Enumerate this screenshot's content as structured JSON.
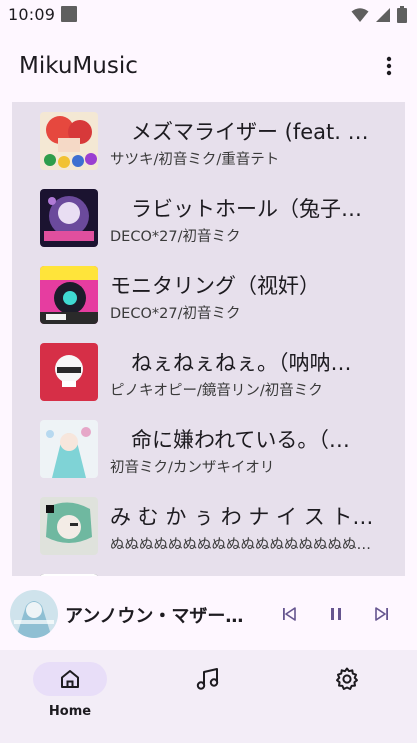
{
  "status_bar": {
    "time": "10:09"
  },
  "app_bar": {
    "title": "MikuMusic"
  },
  "songs": [
    {
      "title": "　メズマライザー (feat. …",
      "artist": "サツキ/初音ミク/重音テト"
    },
    {
      "title": "　ラビットホール（兔子…",
      "artist": "DECO*27/初音ミク"
    },
    {
      "title": "モニタリング（视奸）",
      "artist": "DECO*27/初音ミク"
    },
    {
      "title": "　ねぇねぇねぇ。（呐呐…",
      "artist": "ピノキオピー/鏡音リン/初音ミク"
    },
    {
      "title": "　命に嫌われている。（…",
      "artist": "初音ミク/カンザキイオリ"
    },
    {
      "title": "み む か ぅ わ ナ イ ス ト…",
      "artist": "ぬぬぬぬぬぬぬぬぬぬぬぬぬぬぬぬぬ…"
    }
  ],
  "mini_player": {
    "title": "アンノウン・マザー…"
  },
  "bottom_nav": {
    "items": [
      {
        "label": "Home",
        "icon": "home-icon",
        "active": true
      },
      {
        "label": "",
        "icon": "music-note-icon",
        "active": false
      },
      {
        "label": "",
        "icon": "gear-icon",
        "active": false
      }
    ]
  },
  "colors": {
    "background": "#fef7ff",
    "list_panel": "#e7e0ec",
    "nav_bar": "#f3edf7",
    "nav_active_pill": "#e8def8",
    "accent": "#65558f"
  }
}
